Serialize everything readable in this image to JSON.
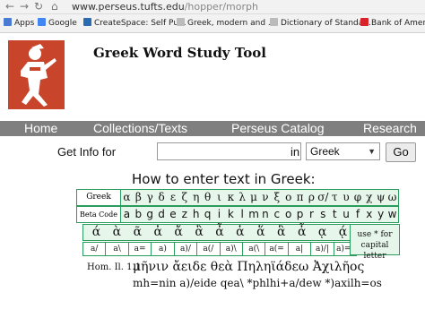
{
  "browser": {
    "url_host": "www.perseus.tufts.edu",
    "url_path": "/hopper/morph",
    "bookmarks": [
      {
        "label": "Apps",
        "color": "#4a7bd4"
      },
      {
        "label": "Google",
        "color": "#4285f4"
      },
      {
        "label": "CreateSpace: Self Pu...",
        "color": "#2b6cb0"
      },
      {
        "label": "Greek, modern and ...",
        "color": "#555555"
      },
      {
        "label": "Dictionary of Standa...",
        "color": "#555555"
      },
      {
        "label": "Bank of America",
        "color": "#d8232a"
      }
    ]
  },
  "site": {
    "title": "Greek Word Study Tool"
  },
  "nav": [
    "Home",
    "Collections/Texts",
    "Perseus Catalog",
    "Research"
  ],
  "search": {
    "label": "Get Info for",
    "value": "",
    "in_label": "in",
    "language": "Greek",
    "go_label": "Go"
  },
  "guide": {
    "heading": "How to enter text in Greek:",
    "greek_label": "Greek",
    "beta_label": "Beta Code",
    "greek_letters": [
      "α",
      "β",
      "γ",
      "δ",
      "ε",
      "ζ",
      "η",
      "θ",
      "ι",
      "κ",
      "λ",
      "μ",
      "ν",
      "ξ",
      "ο",
      "π",
      "ρ",
      "σ/ς",
      "τ",
      "υ",
      "φ",
      "χ",
      "ψ",
      "ω"
    ],
    "beta_letters": [
      "a",
      "b",
      "g",
      "d",
      "e",
      "z",
      "h",
      "q",
      "i",
      "k",
      "l",
      "m",
      "n",
      "c",
      "o",
      "p",
      "r",
      "s",
      "t",
      "u",
      "f",
      "x",
      "y",
      "w"
    ],
    "accented": [
      "ά",
      "ὰ",
      "ᾶ",
      "ἀ",
      "ἄ",
      "ἂ",
      "ἆ",
      "ἁ",
      "ἅ",
      "ἃ",
      "ἇ",
      "ᾳ",
      "ᾴ"
    ],
    "accent_codes": [
      "a/",
      "a\\",
      "a=",
      "a)",
      "a)/",
      "a(/",
      "a)\\",
      "a(\\",
      "a(=",
      "a|",
      "a)/|",
      "a)=|"
    ],
    "capital_note": "use * for capital letter",
    "example_ref": "Hom. Il. 1.1",
    "example_greek": "μῆνιν ἄειδε θεὰ Πηληϊάδεω Ἀχιλῆος",
    "example_beta": "mh=nin a)/eide qea\\ *phlhi+a/dew *)axilh=os"
  }
}
